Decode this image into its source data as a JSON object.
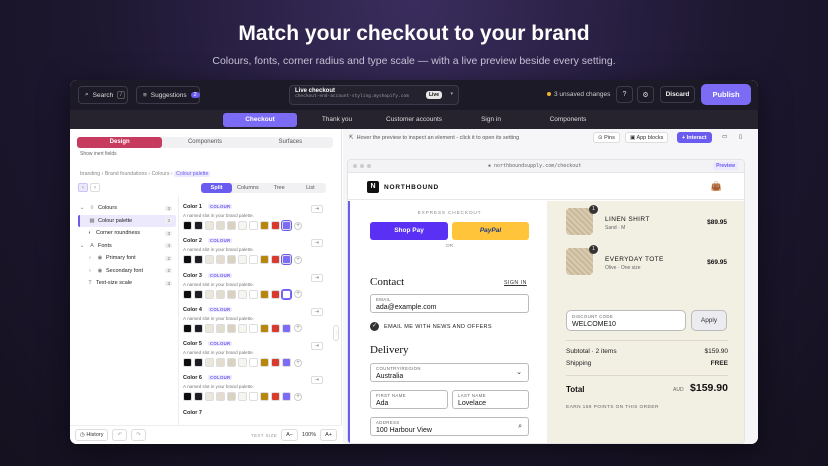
{
  "hero": {
    "title": "Match your checkout to your brand",
    "subtitle": "Colours, fonts, corner radius and type scale — with a live preview beside every setting."
  },
  "topbar": {
    "search_label": "Search",
    "search_kbd": "/",
    "suggestions_label": "Suggestions",
    "suggestions_count": "2",
    "live_title": "Live checkout",
    "live_url": "checkout-end-account-styling.myshopify.com",
    "live_tag": "Live",
    "unsaved": "3 unsaved changes",
    "help": "?",
    "discard": "Discard",
    "publish": "Publish"
  },
  "page_tabs": [
    "Checkout",
    "Thank you",
    "Customer accounts",
    "Sign in",
    "Components"
  ],
  "left": {
    "segments": [
      "Design",
      "Components",
      "Surfaces"
    ],
    "show_inert": "Show inert fields",
    "breadcrumb": [
      "branding",
      "Brand foundations",
      "Colours",
      "Colour palette"
    ],
    "views": [
      "Split",
      "Columns",
      "Tree",
      "List"
    ],
    "tree": [
      {
        "label": "Colours",
        "count": "3",
        "icon": "drop-icon"
      },
      {
        "label": "Colour palette",
        "count": "3",
        "icon": "grid-icon"
      },
      {
        "label": "Corner roundness",
        "count": "3",
        "icon": "half-circle-icon"
      },
      {
        "label": "Fonts",
        "count": "4",
        "icon": "font-icon"
      },
      {
        "label": "Primary font",
        "count": "2",
        "icon": "circle-icon"
      },
      {
        "label": "Secondary font",
        "count": "2",
        "icon": "circle-icon"
      },
      {
        "label": "Text-size scale",
        "count": "3",
        "icon": "text-size-icon"
      }
    ],
    "colors": [
      {
        "name": "Color 1",
        "tag": "COLOUR",
        "desc": "A named slot in your brand palette."
      },
      {
        "name": "Color 2",
        "tag": "COLOUR",
        "desc": "A named slot in your brand palette."
      },
      {
        "name": "Color 3",
        "tag": "COLOUR",
        "desc": "A named slot in your brand palette."
      },
      {
        "name": "Color 4",
        "tag": "COLOUR",
        "desc": "A named slot in your brand palette."
      },
      {
        "name": "Color 5",
        "tag": "COLOUR",
        "desc": "A named slot in your brand palette."
      },
      {
        "name": "Color 6",
        "tag": "COLOUR",
        "desc": "A named slot in your brand palette."
      },
      {
        "name": "Color 7",
        "tag": "",
        "desc": ""
      }
    ],
    "swatches": [
      "#0d0d10",
      "#1e1e24",
      "#ece7dc",
      "#e3ddd0",
      "#d9d2c0",
      "#f7f5f0",
      "#ffffff",
      "#b8860b",
      "#d83a2e",
      "#7c6cf5"
    ],
    "footer": {
      "history": "History",
      "text_size": "TEXT SIZE",
      "a_minus": "A−",
      "zoom": "100%",
      "a_plus": "A+"
    }
  },
  "right": {
    "hint": "Hover the preview to inspect an element - click it to open its setting",
    "pins": "Pins",
    "app_blocks": "App blocks",
    "interact": "Interact",
    "url": "northboundsupply.com/checkout",
    "preview": "Preview"
  },
  "checkout": {
    "brand_letter": "N",
    "brand": "NORTHBOUND",
    "express": "EXPRESS CHECKOUT",
    "shop_pay": "Shop Pay",
    "paypal": "PayPal",
    "or": "OR",
    "contact": "Contact",
    "sign_in": "SIGN IN",
    "email_label": "EMAIL",
    "email_value": "ada@example.com",
    "news": "EMAIL ME WITH NEWS AND OFFERS",
    "delivery": "Delivery",
    "country_label": "COUNTRY/REGION",
    "country_value": "Australia",
    "first_label": "FIRST NAME",
    "first_value": "Ada",
    "last_label": "LAST NAME",
    "last_value": "Lovelace",
    "address_label": "ADDRESS",
    "address_value": "100 Harbour View"
  },
  "summary": {
    "items": [
      {
        "qty": "1",
        "name": "LINEN SHIRT",
        "variant": "Sand · M",
        "price": "$89.95"
      },
      {
        "qty": "1",
        "name": "EVERYDAY TOTE",
        "variant": "Olive · One size",
        "price": "$69.95"
      }
    ],
    "discount_label": "DISCOUNT CODE",
    "discount_value": "WELCOME10",
    "apply": "Apply",
    "subtotal_label": "Subtotal · 2 items",
    "subtotal_value": "$159.90",
    "shipping_label": "Shipping",
    "shipping_value": "FREE",
    "total_label": "Total",
    "currency": "AUD",
    "total_value": "$159.90",
    "earn": "EARN 159 POINTS ON THIS ORDER"
  },
  "colors": {
    "accent": "#7c6cf5",
    "design_tab": "#c63b5e",
    "shop_pay": "#5a31f4",
    "paypal": "#ffc439"
  }
}
